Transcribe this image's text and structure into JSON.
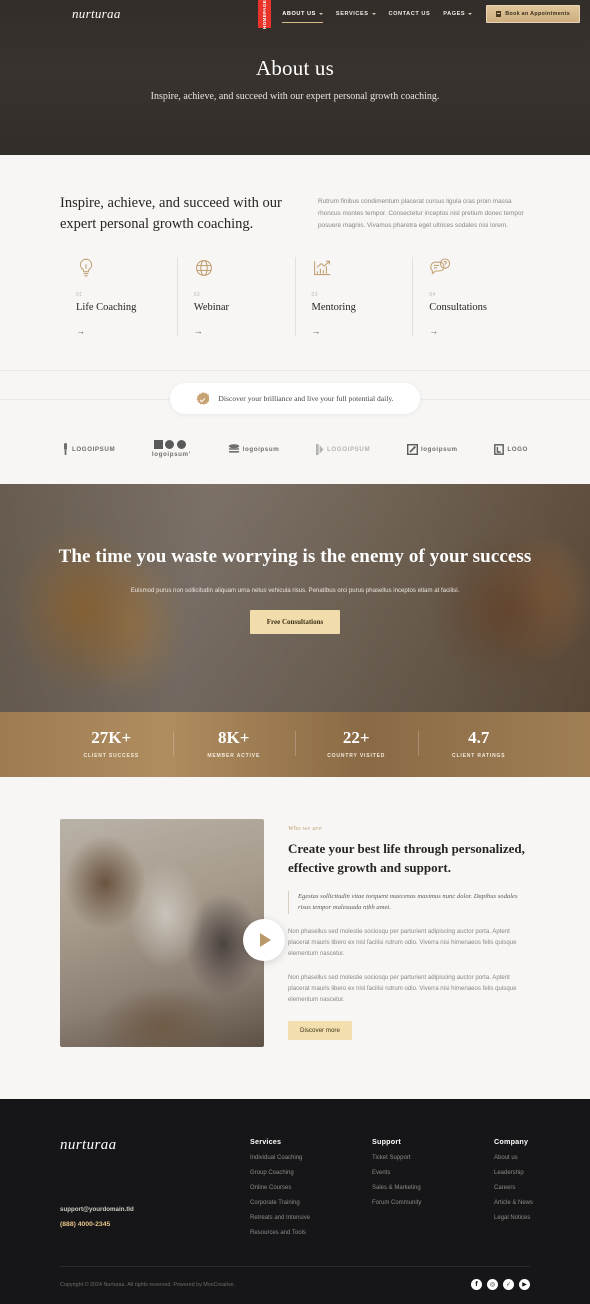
{
  "nav": {
    "logo": "nurturaa",
    "homepage_tab": "HOMEPAGE",
    "items": [
      {
        "label": "ABOUT US",
        "caret": true,
        "active": true
      },
      {
        "label": "SERVICES",
        "caret": true,
        "active": false
      },
      {
        "label": "CONTACT US",
        "caret": false,
        "active": false
      },
      {
        "label": "PAGES",
        "caret": true,
        "active": false
      }
    ],
    "cta_label": "Book an Appointments",
    "cta_icon": "calendar-icon"
  },
  "hero": {
    "title": "About us",
    "subtitle": "Inspire, achieve, and succeed with our expert personal growth coaching."
  },
  "intro": {
    "heading": "Inspire, achieve, and succeed with our expert personal growth coaching.",
    "paragraph": "Rutrum finibus condimentum placerat cursus ligula cras proin massa rhoncus montes tempor. Consectetur inceptos nisl pretium donec tempor posuere magnis. Vivamus pharetra eget ultrices sodales nisi lorem."
  },
  "services": [
    {
      "num": "01",
      "name": "Life Coaching",
      "icon": "lightbulb-icon",
      "arrow": "→"
    },
    {
      "num": "02",
      "name": "Webinar",
      "icon": "globe-icon",
      "arrow": "→"
    },
    {
      "num": "03",
      "name": "Mentoring",
      "icon": "chart-growth-icon",
      "arrow": "→"
    },
    {
      "num": "04",
      "name": "Consultations",
      "icon": "chat-question-icon",
      "arrow": "→"
    }
  ],
  "banner": {
    "icon": "verified-badge-icon",
    "text": "Discover your brilliance and live your full potential daily."
  },
  "logos": [
    {
      "name": "logoipsum-1",
      "text": "LOGOIPSUM"
    },
    {
      "name": "logoipsum-2",
      "text": "logoipsum’"
    },
    {
      "name": "logoipsum-3",
      "text": "logoipsum"
    },
    {
      "name": "logoipsum-4",
      "text": "LOGOIPSUM"
    },
    {
      "name": "logoipsum-5",
      "text": "logoipsum"
    },
    {
      "name": "logoipsum-6",
      "text": "LOGO"
    }
  ],
  "quote": {
    "heading": "The time you waste worrying is the enemy of your success",
    "paragraph": "Euismod purus non sollicitudin aliquam urna netus vehicula risus. Penatibus orci purus phasellus inceptos etiam at facilisi.",
    "button": "Free Consultations"
  },
  "stats": [
    {
      "value": "27K+",
      "label": "CLIENT SUCCESS"
    },
    {
      "value": "8K+",
      "label": "MEMBER ACTIVE"
    },
    {
      "value": "22+",
      "label": "COUNTRY VISITED"
    },
    {
      "value": "4.7",
      "label": "CLIENT RATINGS"
    }
  ],
  "about": {
    "eyebrow": "Who we are",
    "heading": "Create your best life through personalized, effective growth and support.",
    "quote": "Egestas sollicitudin vitae torquent maecenas maximus nunc dolor. Dapibus sodales risus tempor malesuada nibh amet.",
    "paragraph1": "Non phasellus sed molestie sociosqu per parturient adipiscing auctor porta. Aptent placerat mauris libero ex nisl facilisi rutrum odio. Viverra nisi himenaeos felis quisque elementum nascetur.",
    "paragraph2": "Non phasellus sed molestie sociosqu per parturient adipiscing auctor porta. Aptent placerat mauris libero ex nisl facilisi rutrum odio. Viverra nisi himenaeos felis quisque elementum nascetur.",
    "button": "Discover more",
    "play_icon": "play-icon"
  },
  "footer": {
    "logo": "nurturaa",
    "email": "support@yourdomain.tld",
    "phone": "(888) 4000-2345",
    "columns": [
      {
        "heading": "Services",
        "items": [
          "Individual Coaching",
          "Group Coaching",
          "Online Courses",
          "Corporate Training",
          "Retreats and Intensive",
          "Resources and Tools"
        ]
      },
      {
        "heading": "Support",
        "items": [
          "Ticket Support",
          "Events",
          "Sales & Marketing",
          "Forum Community"
        ]
      },
      {
        "heading": "Company",
        "items": [
          "About us",
          "Leadership",
          "Careers",
          "Article & News",
          "Legal Notices"
        ]
      }
    ],
    "copyright": "Copyright © 2024 Nurturaa. All rights reserved. Powered by MoxCreative.",
    "socials": [
      {
        "name": "facebook-icon",
        "glyph": "f"
      },
      {
        "name": "instagram-icon",
        "glyph": "◎"
      },
      {
        "name": "twitter-icon",
        "glyph": "✓"
      },
      {
        "name": "youtube-icon",
        "glyph": "▶"
      }
    ]
  },
  "colors": {
    "accent_gold": "#c8a273",
    "cta_cream": "#f1dcab",
    "homepage_red": "#e8342a",
    "footer_bg": "#161618",
    "page_bg": "#f7f6f4"
  }
}
